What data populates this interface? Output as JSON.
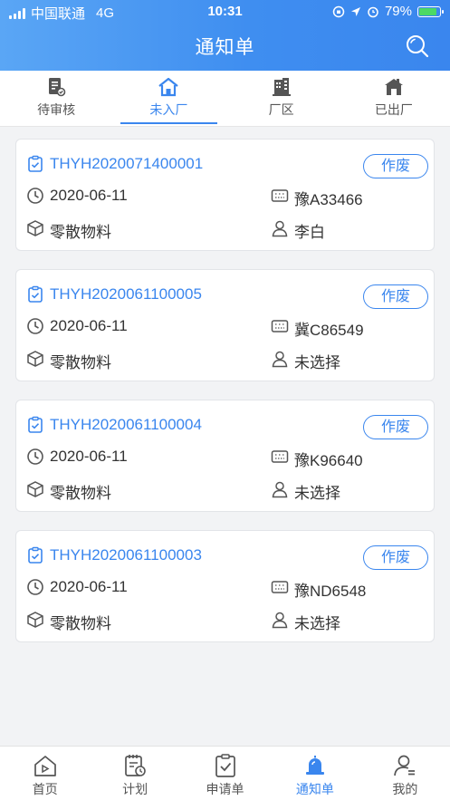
{
  "status_bar": {
    "carrier": "中国联通",
    "network": "4G",
    "time": "10:31",
    "battery": "79%"
  },
  "header": {
    "title": "通知单"
  },
  "tabs": [
    {
      "label": "待审核",
      "icon": "review-doc-icon"
    },
    {
      "label": "未入厂",
      "icon": "home-icon",
      "active": true
    },
    {
      "label": "厂区",
      "icon": "building-icon"
    },
    {
      "label": "已出厂",
      "icon": "factory-exit-icon"
    }
  ],
  "cards": [
    {
      "code": "THYH2020071400001",
      "void_label": "作废",
      "date": "2020-06-11",
      "plate": "豫A33466",
      "material": "零散物料",
      "person": "李白"
    },
    {
      "code": "THYH2020061100005",
      "void_label": "作废",
      "date": "2020-06-11",
      "plate": "冀C86549",
      "material": "零散物料",
      "person": "未选择"
    },
    {
      "code": "THYH2020061100004",
      "void_label": "作废",
      "date": "2020-06-11",
      "plate": "豫K96640",
      "material": "零散物料",
      "person": "未选择"
    },
    {
      "code": "THYH2020061100003",
      "void_label": "作废",
      "date": "2020-06-11",
      "plate": "豫ND6548",
      "material": "零散物料",
      "person": "未选择"
    }
  ],
  "tabbar": [
    {
      "label": "首页",
      "icon": "home-play-icon"
    },
    {
      "label": "计划",
      "icon": "plan-icon"
    },
    {
      "label": "申请单",
      "icon": "application-icon"
    },
    {
      "label": "通知单",
      "icon": "notice-bell-icon",
      "active": true
    },
    {
      "label": "我的",
      "icon": "user-icon"
    }
  ],
  "colors": {
    "accent": "#3a86ee",
    "header_gradient_start": "#5aa6f5",
    "background": "#f2f3f5"
  }
}
